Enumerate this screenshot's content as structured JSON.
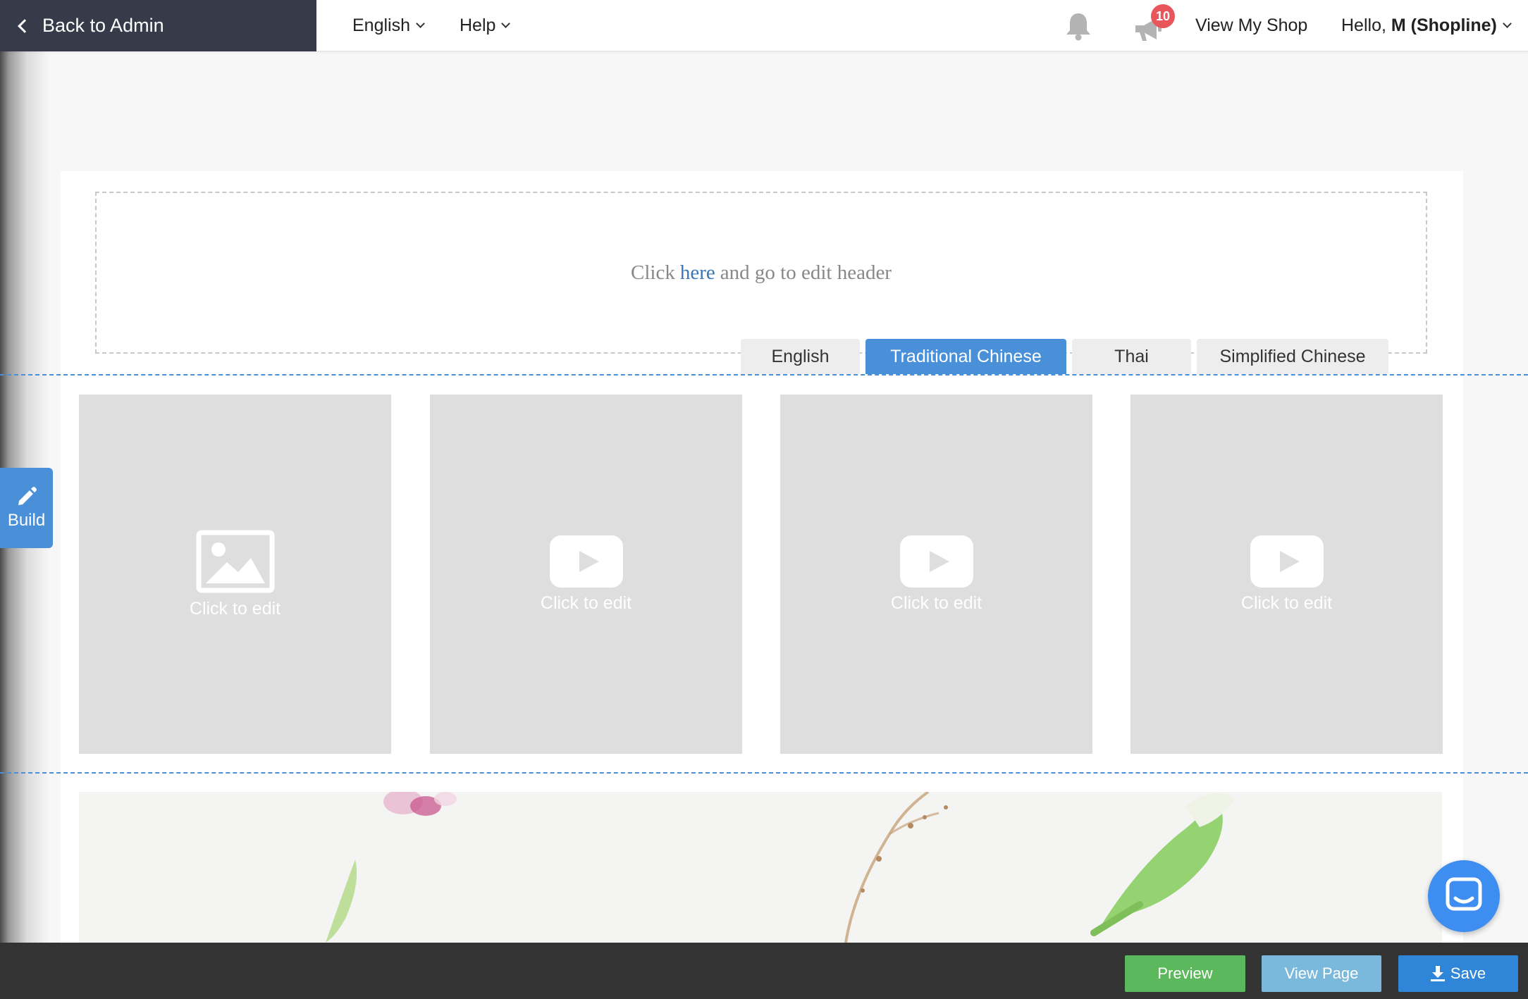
{
  "topbar": {
    "back_label": "Back to Admin",
    "language_label": "English",
    "help_label": "Help",
    "notification_count": "10",
    "view_shop_label": "View My Shop",
    "hello_prefix": "Hello,",
    "user_name": "M (Shopline)"
  },
  "sidebar": {
    "build_label": "Build"
  },
  "header_section": {
    "text_before": "Click",
    "link_text": "here",
    "text_after": "and go to edit header"
  },
  "language_tabs": {
    "active": "Traditional Chinese",
    "tabs": [
      "English",
      "Traditional Chinese",
      "Thai",
      "Simplified Chinese"
    ]
  },
  "tiles": [
    {
      "type": "image",
      "icon": "image-placeholder-icon",
      "label": "Click to edit"
    },
    {
      "type": "video",
      "icon": "video-play-icon",
      "label": "Click to edit"
    },
    {
      "type": "video",
      "icon": "video-play-icon",
      "label": "Click to edit"
    },
    {
      "type": "video",
      "icon": "video-play-icon",
      "label": "Click to edit"
    }
  ],
  "bottombar": {
    "preview_label": "Preview",
    "view_page_label": "View Page",
    "save_label": "Save"
  },
  "colors": {
    "accent": "#4a90d9",
    "preview": "#5cb85c",
    "view_page": "#7ab8dc",
    "save": "#2f86d8",
    "admin_bar": "#353b48"
  }
}
